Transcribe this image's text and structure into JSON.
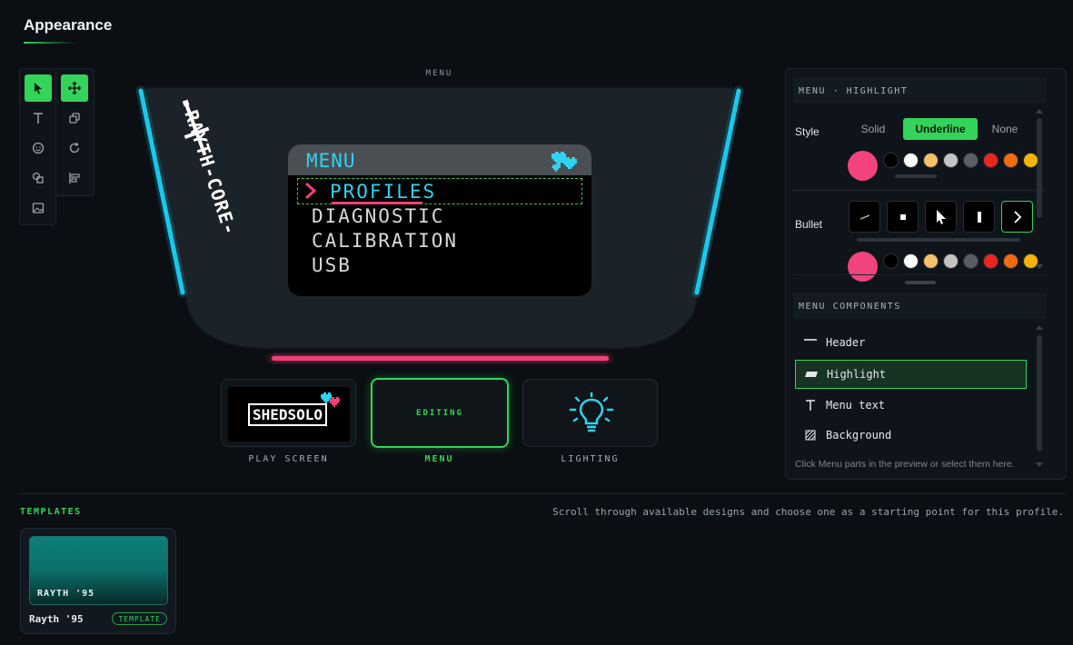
{
  "page": {
    "title": "Appearance"
  },
  "tools": {
    "select": "select-icon",
    "move": "move-icon",
    "text": "text-icon",
    "duplicate": "duplicate-icon",
    "emoji": "emoji-icon",
    "rotate": "rotate-icon",
    "shapes": "shapes-icon",
    "align": "align-icon",
    "image": "image-icon"
  },
  "preview": {
    "top_label": "MENU",
    "brand_text": "RAYTH-CORE-",
    "screen_title": "MENU",
    "items": [
      "PROFILES",
      "DIAGNOSTIC",
      "CALIBRATION",
      "USB"
    ],
    "selected_index": 0,
    "accent_cyan": "#2fd2f0",
    "accent_pink": "#f0407a"
  },
  "screens": [
    {
      "label": "PLAY SCREEN",
      "logo": "SHEDSOLO"
    },
    {
      "label": "MENU",
      "status": "EDITING"
    },
    {
      "label": "LIGHTING"
    }
  ],
  "panel": {
    "highlight_header": "MENU · HIGHLIGHT",
    "style_label": "Style",
    "style_options": [
      "Solid",
      "Underline",
      "None"
    ],
    "style_selected": "Underline",
    "bullet_label": "Bullet",
    "selected_color": "#f2437e",
    "palette": [
      "#000000",
      "#ffffff",
      "#f5c06a",
      "#c4c4c4",
      "#5a5e63",
      "#e8251f",
      "#f26b10",
      "#f5b400"
    ],
    "components_header": "MENU COMPONENTS",
    "components": [
      {
        "label": "Header",
        "icon": "header-icon"
      },
      {
        "label": "Highlight",
        "icon": "highlight-icon",
        "active": true
      },
      {
        "label": "Menu text",
        "icon": "text-icon"
      },
      {
        "label": "Background",
        "icon": "background-icon"
      }
    ],
    "hint": "Click Menu parts in the preview or select them here."
  },
  "templates": {
    "label": "TEMPLATES",
    "hint": "Scroll through available designs and choose one as a starting point for this profile.",
    "items": [
      {
        "name": "Rayth '95",
        "preview_name": "RAYTH '95",
        "badge": "TEMPLATE"
      }
    ]
  }
}
